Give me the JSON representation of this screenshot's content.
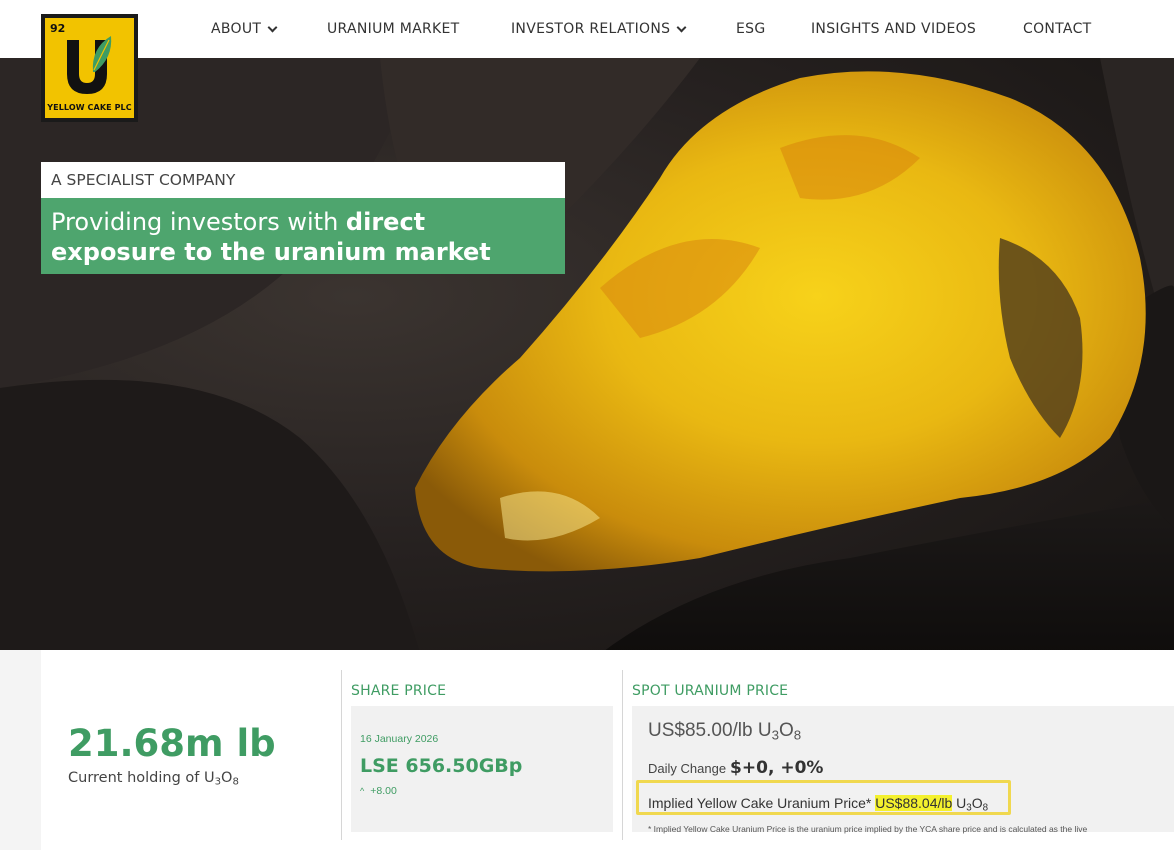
{
  "logo": {
    "number": "92",
    "letter": "U",
    "name": "YELLOW CAKE PLC",
    "icon": "leaf-icon",
    "colors": {
      "bg": "#f2c300",
      "border": "#1a1a1a",
      "leaf": "#3f9c63"
    }
  },
  "nav": {
    "items": [
      {
        "label": "ABOUT",
        "has_dropdown": true
      },
      {
        "label": "URANIUM MARKET",
        "has_dropdown": false
      },
      {
        "label": "INVESTOR RELATIONS",
        "has_dropdown": true
      },
      {
        "label": "ESG",
        "has_dropdown": false
      },
      {
        "label": "INSIGHTS AND VIDEOS",
        "has_dropdown": false
      },
      {
        "label": "CONTACT",
        "has_dropdown": false
      }
    ]
  },
  "hero": {
    "kicker": "A SPECIALIST COMPANY",
    "headline_plain": "Providing investors with ",
    "headline_bold": "direct exposure to the uranium market",
    "image": "yellow uranium ore rock on dark coal"
  },
  "holding": {
    "value": "21.68m lb",
    "label_prefix": "Current holding of U",
    "label_sub1": "3",
    "label_mid": "O",
    "label_sub2": "8"
  },
  "share_price": {
    "title": "SHARE PRICE",
    "date": "16 January 2026",
    "price": "LSE 656.50GBp",
    "change": "+8.00",
    "change_icon": "up-caret-icon"
  },
  "spot": {
    "title": "SPOT URANIUM PRICE",
    "price_prefix": "US$85.00/lb U",
    "price_sub1": "3",
    "price_mid": "O",
    "price_sub2": "8",
    "daily_label": "Daily Change",
    "daily_value": "$+0, +0%",
    "implied_label": "Implied Yellow Cake Uranium Price*",
    "implied_value": "US$88.04/lb",
    "implied_unit_prefix": " U",
    "implied_sub1": "3",
    "implied_mid": "O",
    "implied_sub2": "8",
    "footnote": "* Implied Yellow Cake Uranium Price is the uranium price implied by the YCA share price and is calculated as the live"
  },
  "colors": {
    "brand_green": "#3f9c63",
    "banner_green": "#4ea56e",
    "highlight_yellow": "#f4f12e",
    "frame_yellow": "#f0d84f"
  }
}
